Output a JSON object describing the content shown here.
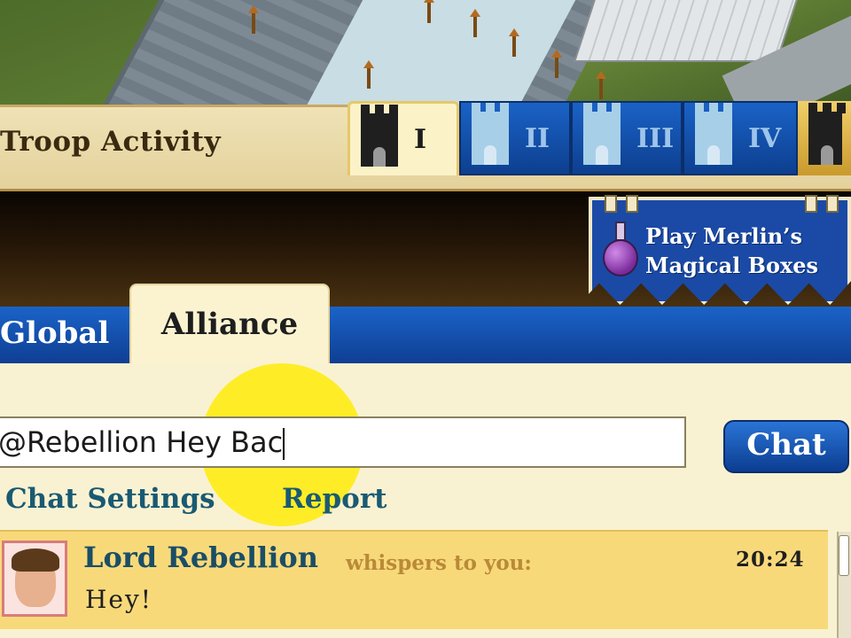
{
  "troop_panel": {
    "title": "Troop Activity",
    "city_tabs": [
      {
        "label": "I",
        "active": true
      },
      {
        "label": "II",
        "active": false
      },
      {
        "label": "III",
        "active": false
      },
      {
        "label": "IV",
        "active": false
      }
    ]
  },
  "promo": {
    "line1": "Play Merlin’s",
    "line2": "Magical Boxes"
  },
  "chat": {
    "tabs": {
      "global": "Global",
      "alliance": "Alliance"
    },
    "input_value": "@Rebellion Hey Bac",
    "send_label": "Chat",
    "settings_label": "Chat Settings",
    "report_label": "Report"
  },
  "message": {
    "sender": "Lord Rebellion",
    "action": "whispers to you:",
    "time": "20:24",
    "text": "Hey!"
  },
  "colors": {
    "chat_blue": "#1b63c8",
    "panel_cream": "#f9f2d2",
    "message_gold": "#f8d97a",
    "cursor_highlight": "#ffec00"
  }
}
